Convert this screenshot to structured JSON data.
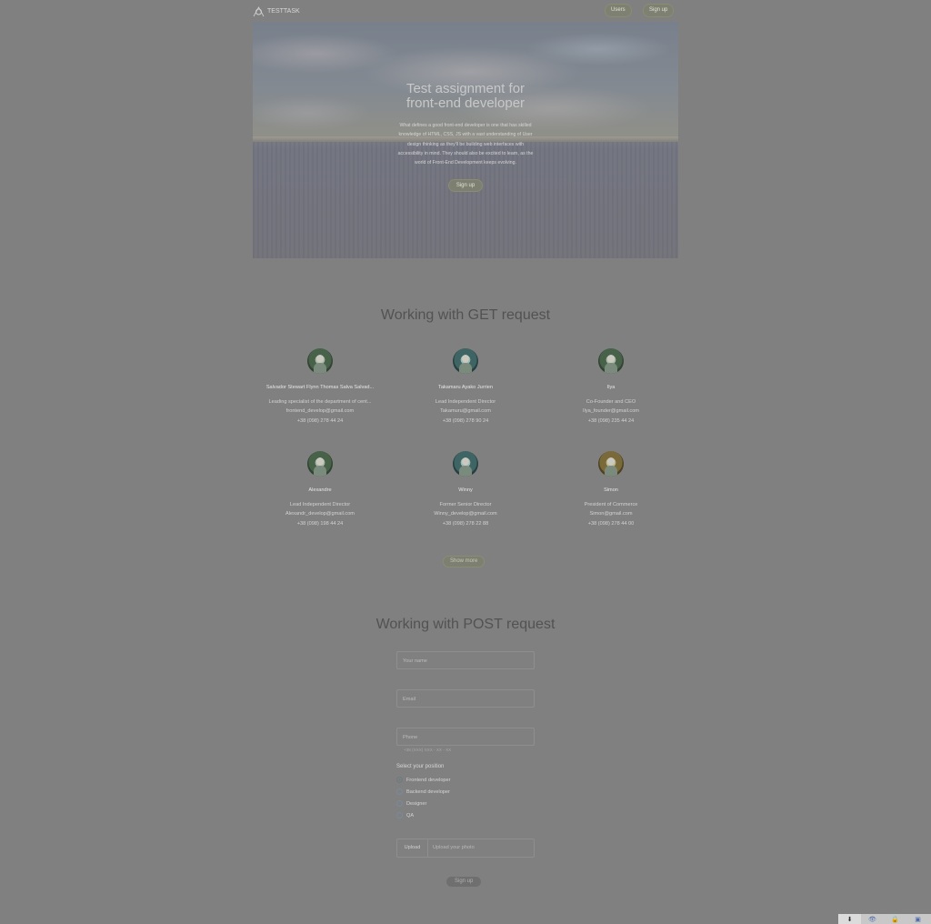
{
  "header": {
    "logo_text": "TESTTASK",
    "users_button": "Users",
    "signup_button": "Sign up"
  },
  "hero": {
    "title": "Test assignment for front-end developer",
    "text": "What defines a good front-end developer is one that has skilled knowledge of HTML, CSS, JS with a vast understanding of User design thinking as they'll be building web interfaces with accessibility in mind. They should also be excited to learn, as the world of Front-End Development keeps evolving.",
    "button": "Sign up"
  },
  "get_section": {
    "title": "Working with GET request",
    "users": [
      {
        "name": "Salvador Stewart Flynn Thomas Salva Salvad...",
        "position": "Leading specialist of the department of cent...",
        "email": "frontend_develop@gmail.com",
        "phone": "+38 (098) 278 44 24",
        "avatar_style": "green"
      },
      {
        "name": "Takamaru Ayako Jurrien",
        "position": "Lead Independent Director",
        "email": "Takamuru@gmail.com",
        "phone": "+38 (098) 278 90 24",
        "avatar_style": "teal"
      },
      {
        "name": "Ilya",
        "position": "Co-Founder and CEO",
        "email": "Ilya_founder@gmail.com",
        "phone": "+38 (098) 235 44 24",
        "avatar_style": "green"
      },
      {
        "name": "Alexandre",
        "position": "Lead Independent Director",
        "email": "Alexandr_develop@gmail.com",
        "phone": "+38 (098) 198 44 24",
        "avatar_style": "green"
      },
      {
        "name": "Winny",
        "position": "Former Senior Director",
        "email": "Winny_develop@gmail.com",
        "phone": "+38 (098) 278 22 88",
        "avatar_style": "teal"
      },
      {
        "name": "Simon",
        "position": "President of Commerce",
        "email": "Simon@gmail.com",
        "phone": "+38 (098) 278 44 00",
        "avatar_style": "warm"
      }
    ],
    "show_more": "Show more"
  },
  "post_section": {
    "title": "Working with POST request",
    "name_placeholder": "Your name",
    "email_placeholder": "Email",
    "phone_placeholder": "Phone",
    "phone_helper": "+38 (XXX) XXX - XX - XX",
    "position_label": "Select your position",
    "positions": [
      "Frontend developer",
      "Backend developer",
      "Designer",
      "QA"
    ],
    "selected_position": "Frontend developer",
    "upload_button": "Upload",
    "upload_placeholder": "Upload your photo",
    "signup_button": "Sign up"
  },
  "statusbar": {
    "icons": [
      "download-icon",
      "eye-icon",
      "lock-icon",
      "extension-icon"
    ]
  }
}
